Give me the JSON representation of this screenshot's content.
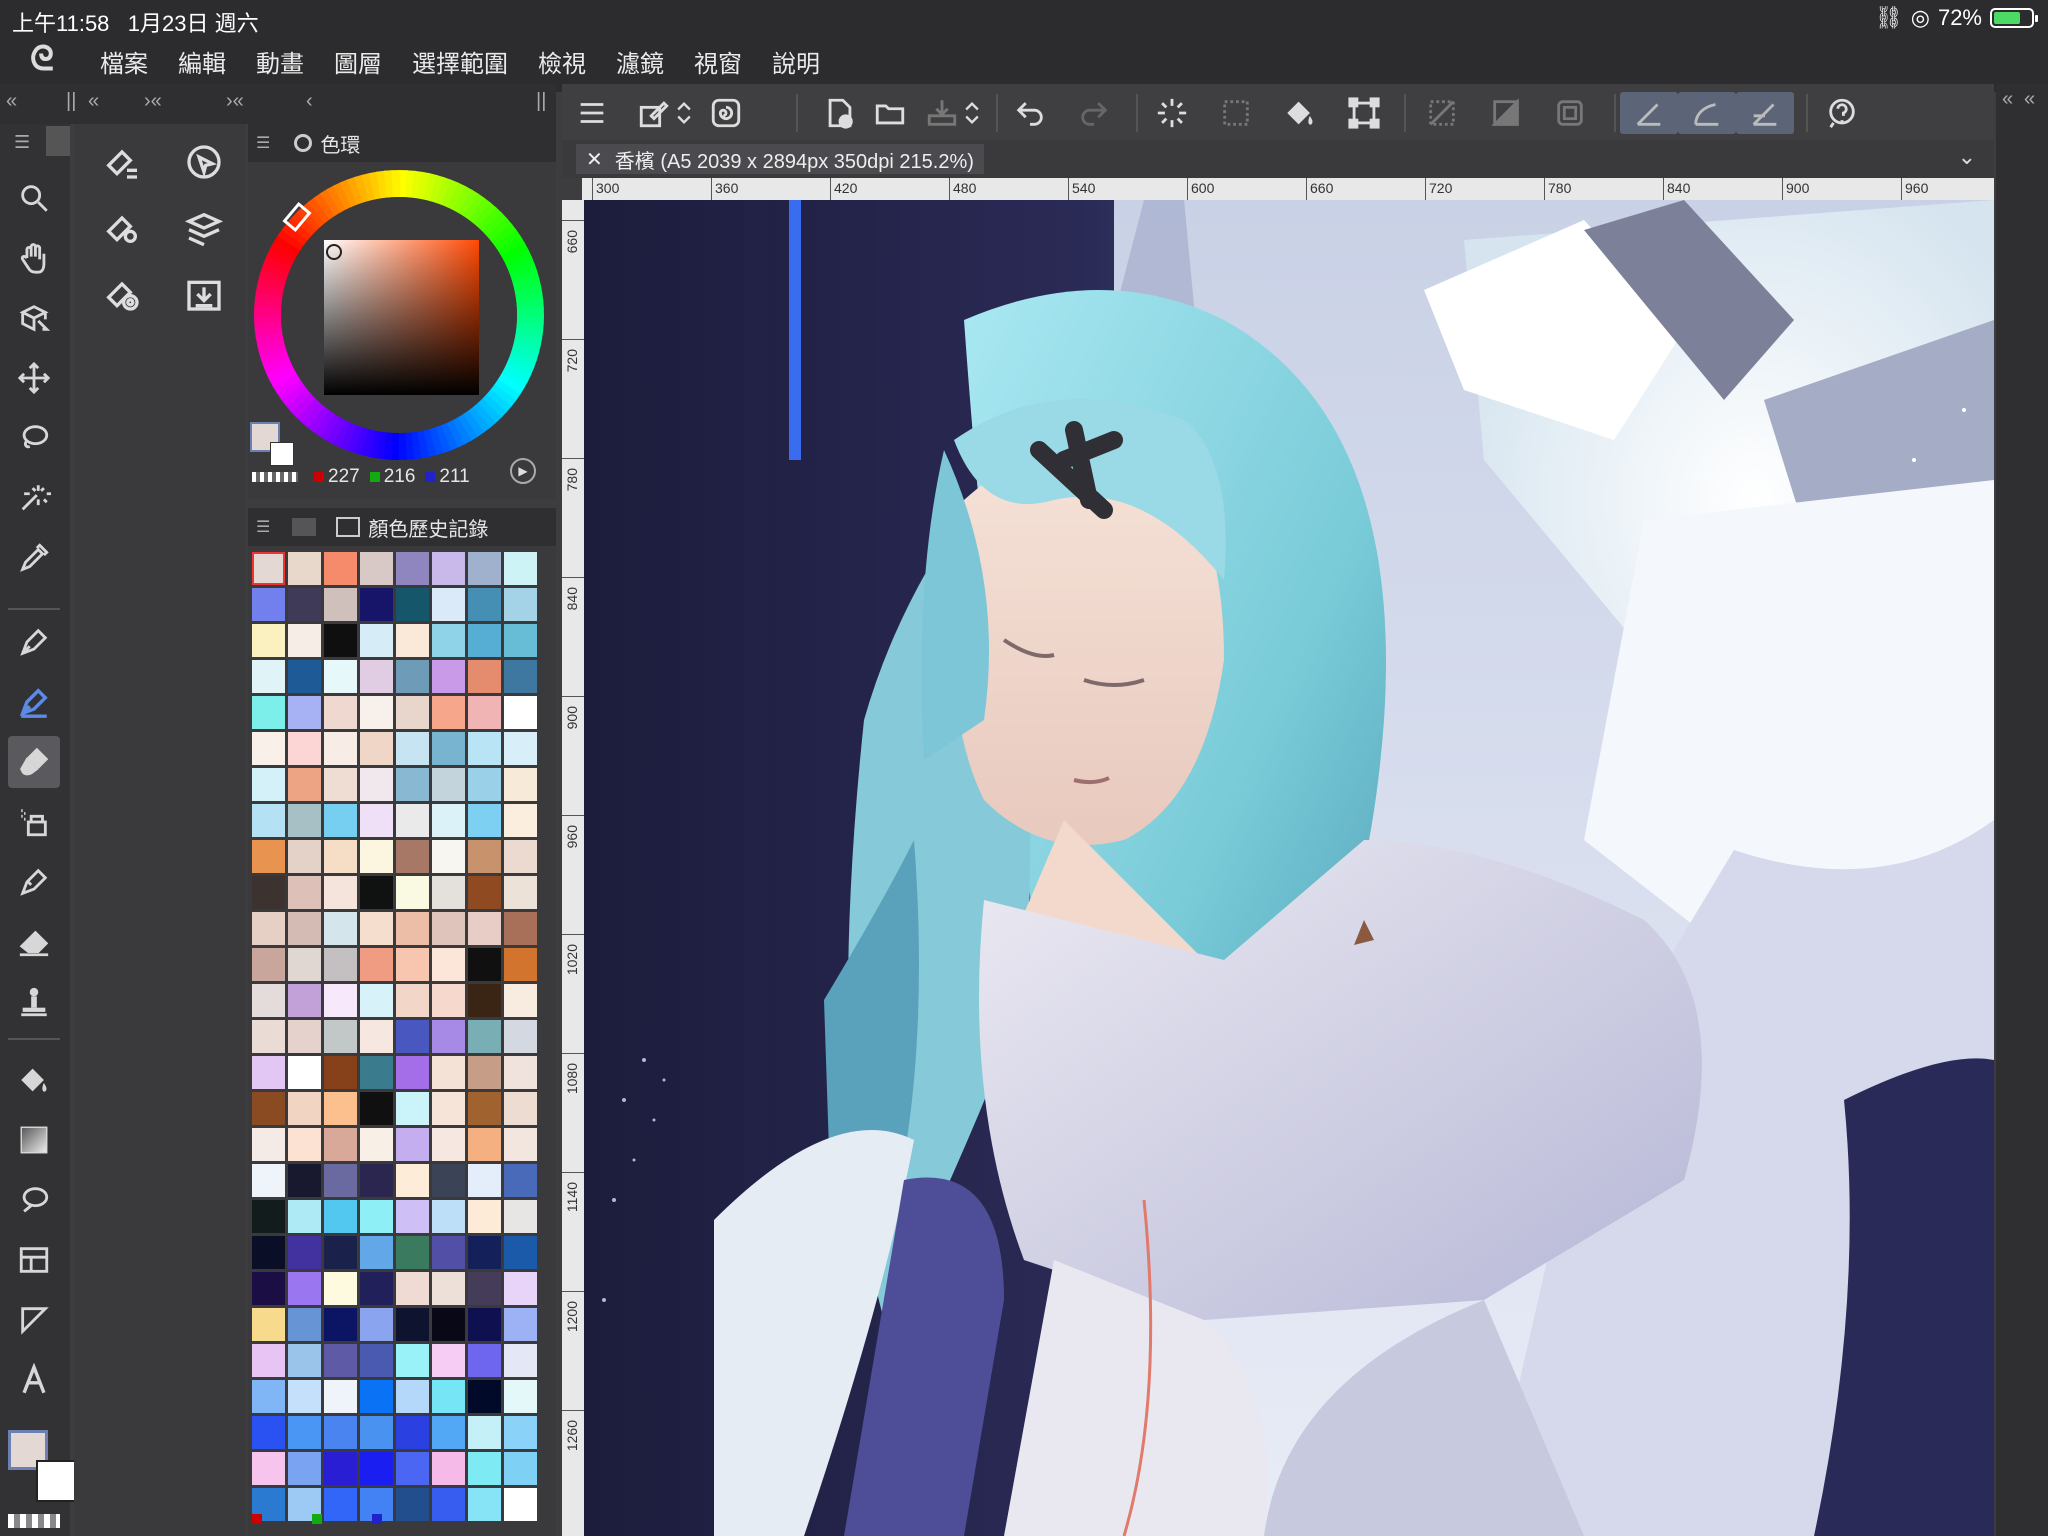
{
  "status_bar": {
    "time": "上午11:58",
    "date": "1月23日 週六",
    "battery": "72%",
    "battery_level": 0.72
  },
  "menu": {
    "items": [
      "檔案",
      "編輯",
      "動畫",
      "圖層",
      "選擇範圍",
      "檢視",
      "濾鏡",
      "視窗",
      "說明"
    ]
  },
  "color_panel": {
    "title": "色環",
    "rgb": {
      "r": "227",
      "g": "216",
      "b": "211"
    },
    "current_color": "#e3d8d3"
  },
  "history_panel": {
    "title": "顏色歷史記錄",
    "swatches": [
      "#e3d8d3",
      "#e8d8cc",
      "#f58b6a",
      "#d8c8c6",
      "#8f86c0",
      "#c9b8ea",
      "#9fb1cc",
      "#cef3f6",
      "#7280ee",
      "#3e3a58",
      "#cfc0bc",
      "#16156a",
      "#15566a",
      "#daeaf8",
      "#468fb4",
      "#a4d2e6",
      "#fbf0c0",
      "#f6eee6",
      "#0f0f10",
      "#d6ecf6",
      "#fae8d8",
      "#8fd3e8",
      "#56aed4",
      "#68bdd6",
      "#e0f4f8",
      "#1e5a96",
      "#e6f8fa",
      "#e0cde4",
      "#6e9bb8",
      "#c89ae8",
      "#e68c6e",
      "#3e78a0",
      "#7cefea",
      "#a6b2f4",
      "#eed8d0",
      "#f8f0ea",
      "#e8d6cc",
      "#f6a68a",
      "#f0b4b4",
      "#ffffff",
      "#faf0ea",
      "#fcd6d4",
      "#f8ece6",
      "#f0d6c6",
      "#c6e4f2",
      "#78b4d0",
      "#b8e4f6",
      "#d8eef8",
      "#d4f0f8",
      "#eca484",
      "#efdcd2",
      "#f0e8ec",
      "#88b8d2",
      "#c4d4dc",
      "#9ad0e8",
      "#f8ead8",
      "#b4e2f4",
      "#a6c0c6",
      "#76cef0",
      "#efe0f8",
      "#eaeaea",
      "#daf2f8",
      "#7ed0f2",
      "#fbeede",
      "#e89450",
      "#e4d2c8",
      "#f6dec6",
      "#fcf6e0",
      "#a87866",
      "#f8f6f0",
      "#c8926c",
      "#ecdad0",
      "#3c3230",
      "#ddc0b8",
      "#f4e4dc",
      "#101212",
      "#fafae2",
      "#e4e0dc",
      "#904a22",
      "#ede2d8",
      "#e6d0c6",
      "#d4bcb4",
      "#d4e6ec",
      "#f6dece",
      "#ecbea8",
      "#dec4ba",
      "#e8ccc6",
      "#a87058",
      "#c8a69c",
      "#e0d6d2",
      "#c4c0c2",
      "#f09c82",
      "#f8c6ae",
      "#fce6da",
      "#101010",
      "#d2742e",
      "#e4dcda",
      "#c2a0d8",
      "#f8e8fc",
      "#d8f2fa",
      "#f2d6c8",
      "#f6d8cc",
      "#3a2414",
      "#f8ece0",
      "#eadbd4",
      "#e6d2cc",
      "#c2c8c8",
      "#f6e8e0",
      "#4858c0",
      "#a68ae6",
      "#78aeb4",
      "#d4d8e0",
      "#e2c6f4",
      "#ffffff",
      "#86401a",
      "#3a7c8e",
      "#a46ee8",
      "#f4e2d6",
      "#c69e88",
      "#f0e2dc",
      "#8a4a22",
      "#f2d4c2",
      "#fbc08e",
      "#101010",
      "#cbf4fa",
      "#f6e4d8",
      "#a0622e",
      "#ecdcd2",
      "#f4ebe6",
      "#fce2d2",
      "#d8a898",
      "#f8f0e6",
      "#c4aef0",
      "#f6e8e0",
      "#f4b080",
      "#f2e6de",
      "#eef4fa",
      "#18182e",
      "#6a6aa0",
      "#2a2650",
      "#fdecd8",
      "#3a4456",
      "#e4eefa",
      "#486ab8",
      "#121c1c",
      "#aeeaf6",
      "#52c8f0",
      "#8ef0f6",
      "#cec0f6",
      "#bde0f8",
      "#fdebd8",
      "#e8e6e4",
      "#0a0e26",
      "#4232a0",
      "#1a224c",
      "#62a8e8",
      "#3a7a5e",
      "#5250a6",
      "#14205a",
      "#1a5aa8",
      "#1a0e44",
      "#9a76f0",
      "#fdfae0",
      "#22205a",
      "#f0dad4",
      "#ece0d8",
      "#443c58",
      "#e8d4f8",
      "#f8da8c",
      "#6694d4",
      "#0c1464",
      "#8aa4f0",
      "#0e1430",
      "#080816",
      "#0e1050",
      "#9cb2f4",
      "#e8c4f4",
      "#9ac4ea",
      "#5e5aa6",
      "#4a5ab0",
      "#98f2f8",
      "#f6ccf4",
      "#6e66ee",
      "#e4e8f6",
      "#80b6f6",
      "#c4e0fa",
      "#eef4fa",
      "#0a72f4",
      "#b4d8fa",
      "#76e6f6",
      "#020a2a",
      "#e4f8fa",
      "#2a52f2",
      "#4a96f4",
      "#4a84f0",
      "#4a92f0",
      "#2a40e0",
      "#52a8f4",
      "#c6f0f8",
      "#8ad2f8",
      "#f6c4ec",
      "#7aa4f2",
      "#2a1ed4",
      "#1a1ef0",
      "#4c66f4",
      "#f6bae8",
      "#7eeaf4",
      "#7ed0f4",
      "#2a7ad2",
      "#9ccaf4",
      "#3266f8",
      "#4282f4",
      "#224e8e",
      "#365cf0",
      "#86e4f6",
      "#ffffff"
    ]
  },
  "document": {
    "tab_title": "香檳 (A5 2039 x 2894px 350dpi 215.2%)",
    "h_ruler": [
      "300",
      "360",
      "420",
      "480",
      "540",
      "600",
      "660",
      "720",
      "780",
      "840",
      "900",
      "960"
    ],
    "v_ruler": [
      "660",
      "720",
      "780",
      "840",
      "900",
      "960",
      "1020",
      "1080",
      "1140",
      "1200",
      "1260"
    ]
  }
}
